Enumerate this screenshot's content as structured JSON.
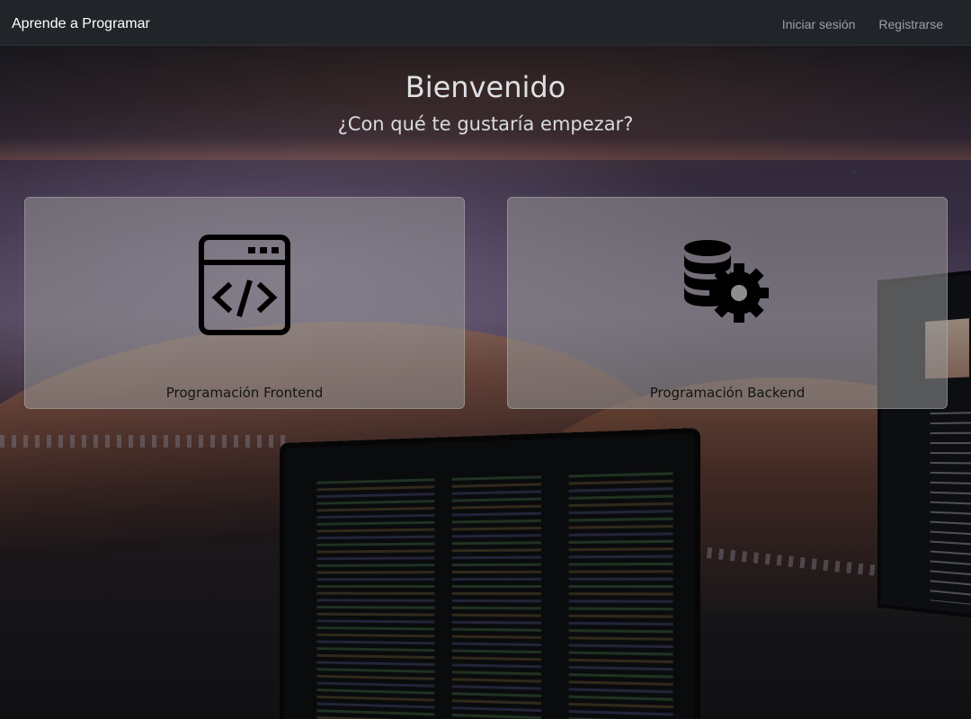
{
  "navbar": {
    "brand": "Aprende a Programar",
    "links": [
      {
        "label": "Iniciar sesión"
      },
      {
        "label": "Registrarse"
      }
    ]
  },
  "hero": {
    "title": "Bienvenido",
    "subtitle": "¿Con qué te gustaría empezar?"
  },
  "cards": [
    {
      "label": "Programación Frontend",
      "icon": "browser-code-icon"
    },
    {
      "label": "Programación Backend",
      "icon": "database-gear-icon"
    }
  ],
  "colors": {
    "navbar_bg": "#212529",
    "nav_link": "#9aa0a6",
    "card_bg": "rgba(150,150,150,0.55)",
    "icon": "#000000"
  }
}
